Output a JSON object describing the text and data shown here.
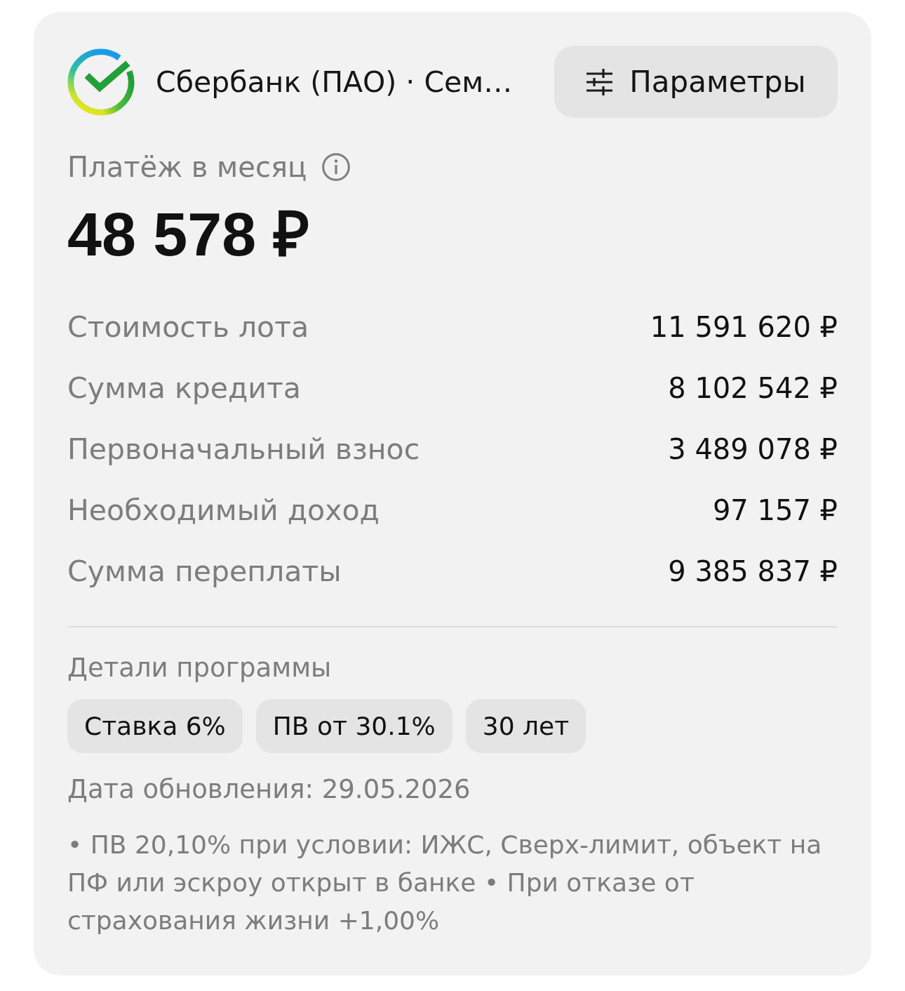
{
  "header": {
    "bank_name": "Сбербанк (ПАО) · Сем…",
    "parameters_button": "Параметры"
  },
  "payment": {
    "label": "Платёж в месяц",
    "amount": "48 578 ₽"
  },
  "summary_rows": [
    {
      "label": "Стоимость лота",
      "value": "11 591 620 ₽"
    },
    {
      "label": "Сумма кредита",
      "value": "8 102 542 ₽"
    },
    {
      "label": "Первоначальный взнос",
      "value": "3 489 078 ₽"
    },
    {
      "label": "Необходимый доход",
      "value": "97 157 ₽"
    },
    {
      "label": "Сумма переплаты",
      "value": "9 385 837 ₽"
    }
  ],
  "program_details": {
    "title": "Детали программы",
    "tags": [
      "Ставка 6%",
      "ПВ от 30.1%",
      "30 лет"
    ]
  },
  "update_date": "Дата обновления: 29.05.2026",
  "footnote": "• ПВ 20,10% при условии: ИЖС, Сверх-лимит, объект на ПФ или эскроу открыт в банке • При отказе от страхования жизни +1,00%"
}
